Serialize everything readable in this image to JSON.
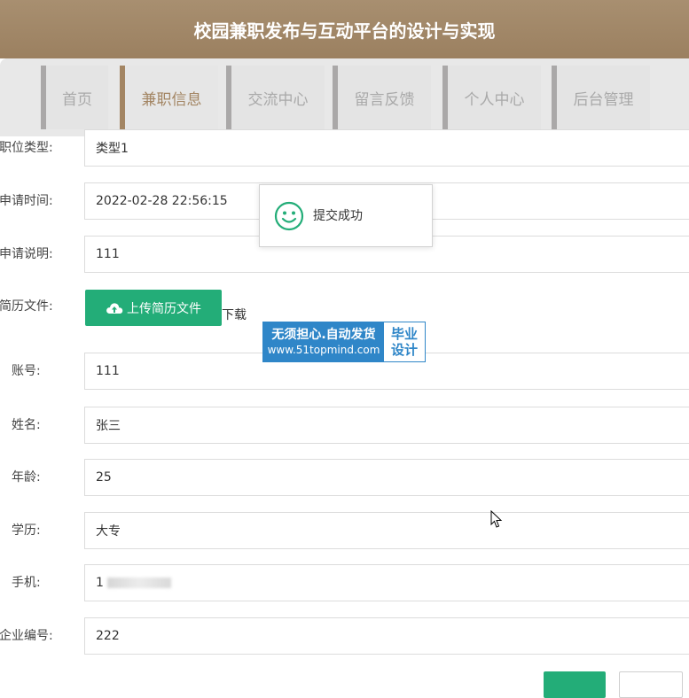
{
  "header": {
    "title": "校园兼职发布与互动平台的设计与实现"
  },
  "nav": {
    "items": [
      {
        "label": "首页"
      },
      {
        "label": "兼职信息"
      },
      {
        "label": "交流中心"
      },
      {
        "label": "留言反馈"
      },
      {
        "label": "个人中心"
      },
      {
        "label": "后台管理"
      }
    ],
    "active": "兼职信息"
  },
  "form": {
    "job_type": {
      "label": "职位类型:",
      "value": "类型1"
    },
    "apply_time": {
      "label": "申请时间:",
      "value": "2022-02-28 22:56:15"
    },
    "apply_desc": {
      "label": "申请说明:",
      "value": "111"
    },
    "resume": {
      "label": "简历文件:",
      "upload_label": "上传简历文件",
      "download_label": "下载"
    },
    "account": {
      "label": "账号:",
      "value": "111"
    },
    "name": {
      "label": "姓名:",
      "value": "张三"
    },
    "age": {
      "label": "年龄:",
      "value": "25"
    },
    "education": {
      "label": "学历:",
      "value": "大专"
    },
    "phone": {
      "label": "手机:",
      "value": "1"
    },
    "company_no": {
      "label": "企业编号:",
      "value": "222"
    }
  },
  "toast": {
    "message": "提交成功",
    "icon": "smile-icon",
    "color": "#23ad78"
  },
  "watermark": {
    "line1": "无须担心.自动发货",
    "line2": "www.51topmind.com",
    "right_line1": "毕业",
    "right_line2": "设计"
  },
  "colors": {
    "header_bg": "#9b8060",
    "accent": "#a38563",
    "primary": "#23ad78",
    "watermark": "#2f86c8"
  }
}
